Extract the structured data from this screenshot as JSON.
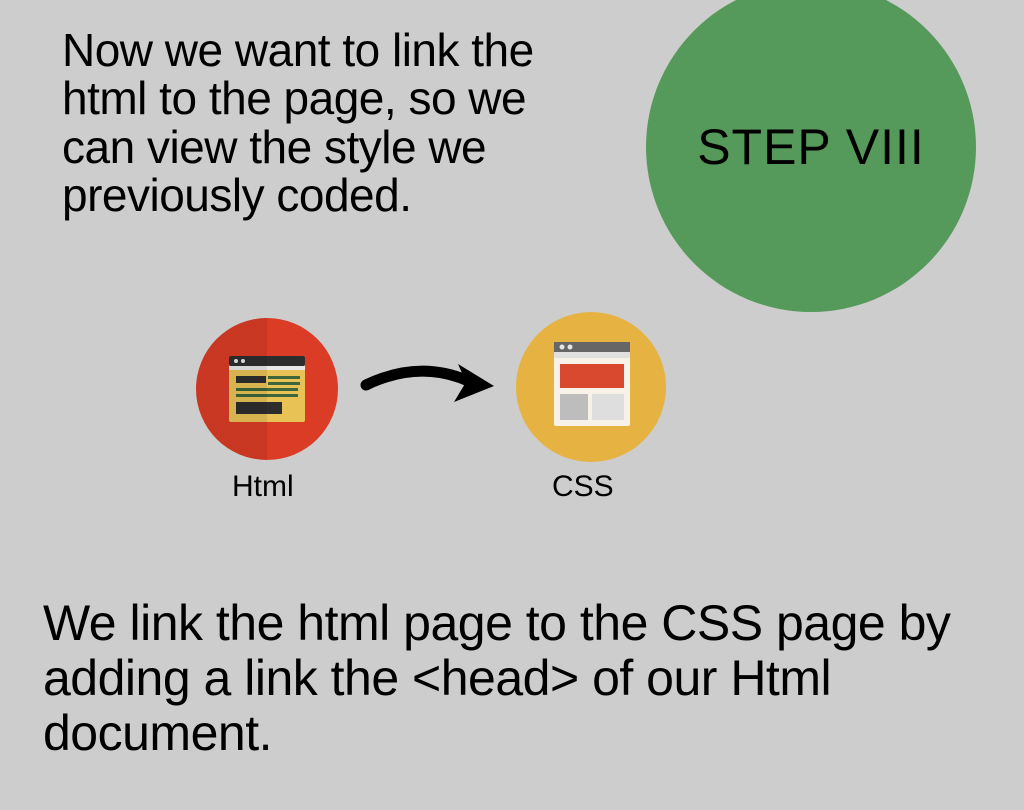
{
  "top_paragraph": "Now we want to link the html to the page, so we can view the style we previously coded.",
  "step_label": "STEP VIII",
  "diagram": {
    "html_label": "Html",
    "css_label": "CSS"
  },
  "bottom_paragraph": "We link the html page to the CSS page by adding a link the <head> of our Html document."
}
